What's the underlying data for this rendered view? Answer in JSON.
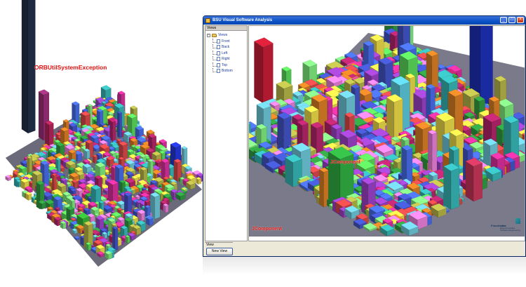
{
  "left_view": {
    "label": "ORBUtilSystemException"
  },
  "window": {
    "title": "BSU Visual Software Analysis",
    "views_header": "Views",
    "tree": {
      "root": "Views",
      "children": [
        "Front",
        "Back",
        "Left",
        "Right",
        "Top",
        "Bottom"
      ]
    },
    "view_label_selected": "JComponent",
    "view_label_bottom": "JComponent",
    "bottom_tab": "View",
    "new_view_label": "New View",
    "logo": {
      "org": "Fraunhofer",
      "line1": "Institut",
      "line2": "Experimentelles",
      "line3": "Software Engineering"
    }
  },
  "colors": {
    "title_bar": "#0a52c8",
    "label_red": "#e01010",
    "window_bg": "#ece9d8"
  }
}
